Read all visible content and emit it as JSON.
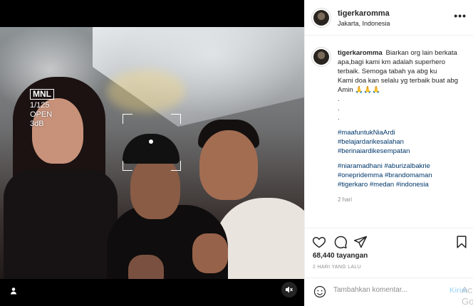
{
  "post": {
    "overlay": {
      "badge": "MNL",
      "shutter": "1/125",
      "aperture": "OPEN",
      "gain": "3dB"
    }
  },
  "header": {
    "username": "tigerkaromma",
    "location": "Jakarta, Indonesia",
    "more_icon": "more-horizontal-icon"
  },
  "caption": {
    "username": "tigerkaromma",
    "first_line": "Biarkan org lain berkata apa,bagi kami km adalah superhero terbaik. Semoga tabah ya abg ku",
    "line2": "Kami doa kan selalu yg terbaik buat abg",
    "line3": "Amin 🙏🙏🙏",
    "dots": [
      ".",
      ".",
      "."
    ],
    "hashtags_group1": [
      "#maafuntukNiaArdi",
      "#belajardarikesalahan",
      "#berinaiardikesempatan"
    ],
    "hashtags_group2": [
      "#niaramadhani #aburizalbakrie",
      "#onepridemma #brandomaman",
      "#tigerkaro #medan #indonesia"
    ],
    "time": "2 hari"
  },
  "actions": {
    "like_icon": "heart-icon",
    "comment_icon": "comment-icon",
    "share_icon": "paper-plane-icon",
    "save_icon": "bookmark-icon"
  },
  "likes": "68,440 tayangan",
  "date": "2 HARI YANG LALU",
  "comment_box": {
    "placeholder": "Tambahkan komentar...",
    "post_label": "Kirim"
  },
  "watermark": {
    "line1": "Ac",
    "line2": "Go"
  }
}
